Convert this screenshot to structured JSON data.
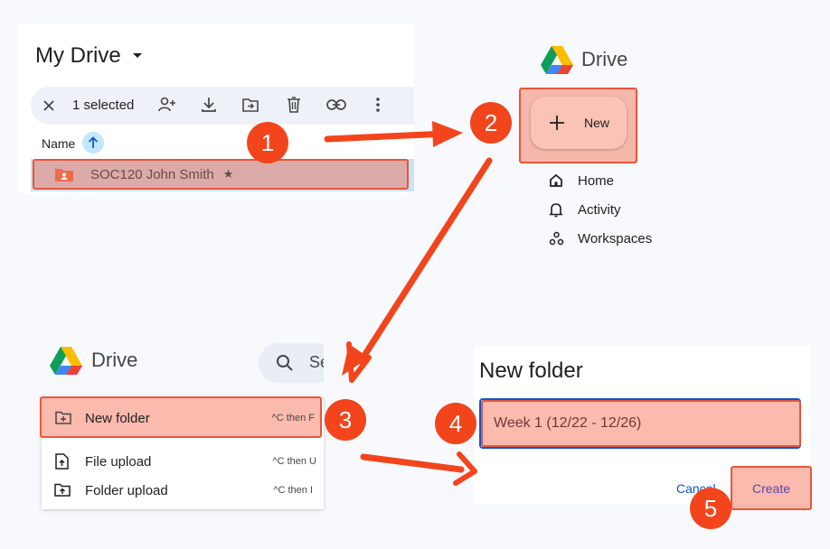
{
  "panel1": {
    "title": "My Drive",
    "toolbar": {
      "selected_count": "1 selected"
    },
    "column_header": "Name",
    "row": {
      "name": "SOC120 John Smith"
    }
  },
  "panel2": {
    "brand": "Drive",
    "new_button": "New",
    "nav": [
      {
        "label": "Home",
        "icon": "home-icon"
      },
      {
        "label": "Activity",
        "icon": "bell-icon"
      },
      {
        "label": "Workspaces",
        "icon": "workspaces-icon"
      }
    ]
  },
  "panel3": {
    "brand": "Drive",
    "search_partial": "Se",
    "menu": [
      {
        "label": "New folder",
        "shortcut": "^C then F",
        "icon": "new-folder-icon"
      },
      {
        "label": "File upload",
        "shortcut": "^C then U",
        "icon": "file-upload-icon"
      },
      {
        "label": "Folder upload",
        "shortcut": "^C then I",
        "icon": "folder-upload-icon"
      }
    ]
  },
  "panel4": {
    "title": "New folder",
    "input_value": "Week 1 (12/22 - 12/26)",
    "cancel_label": "Cancel",
    "create_label": "Create"
  },
  "steps": [
    "1",
    "2",
    "3",
    "4",
    "5"
  ],
  "colors": {
    "highlight": "#f4654a",
    "badge": "#f2451c",
    "arrow": "#f2451c",
    "accent": "#0b57d0",
    "folder": "#f06b4a"
  }
}
